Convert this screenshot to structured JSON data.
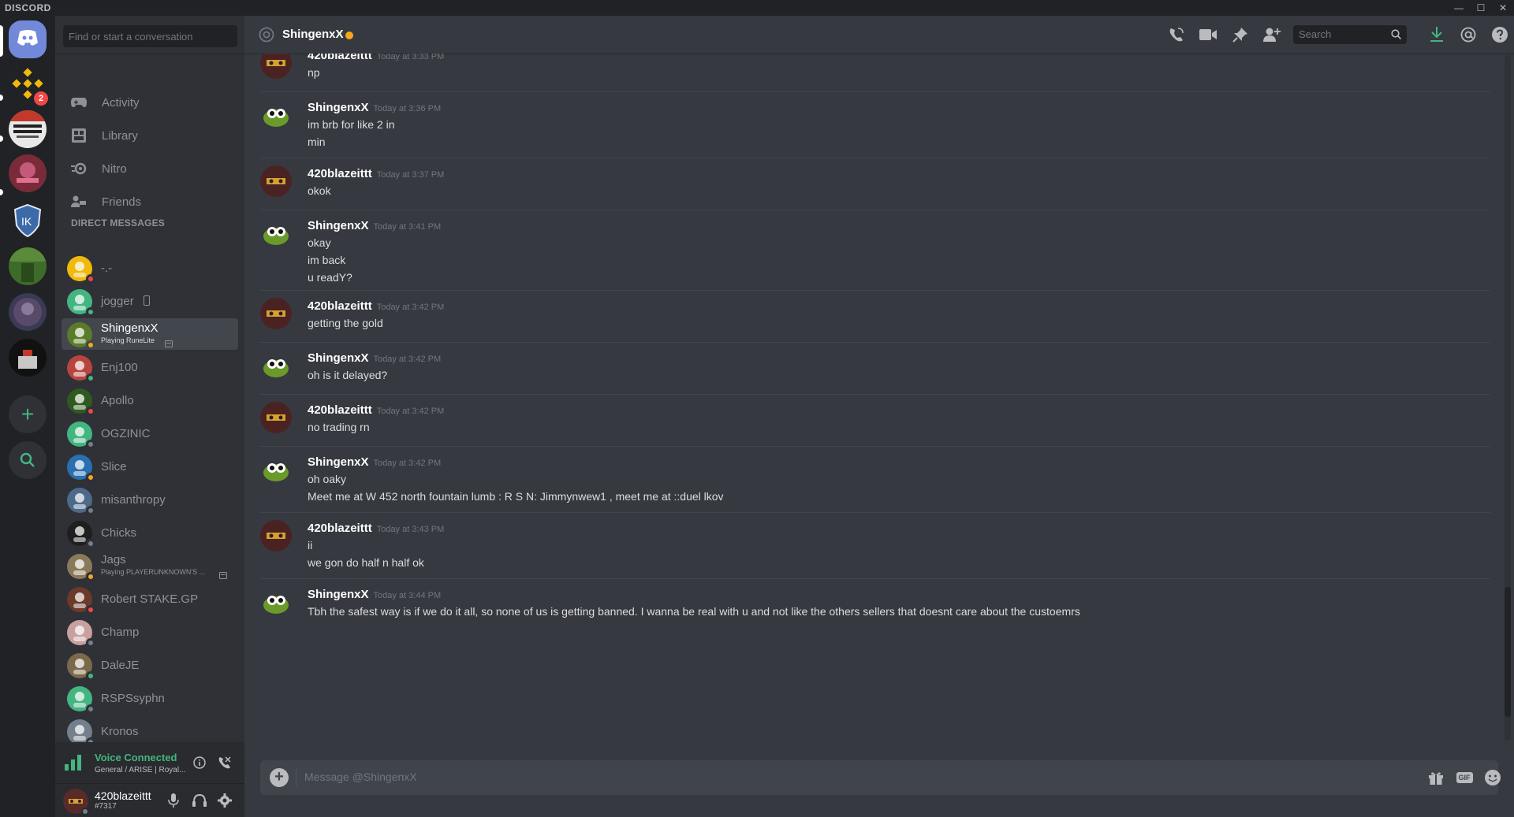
{
  "titlebar": {
    "brand": "DISCORD",
    "minimize": "—",
    "maximize": "☐",
    "close": "✕"
  },
  "guilds": {
    "badge_count": "2",
    "add": "+",
    "explore": "🔍"
  },
  "sidebar": {
    "search_placeholder": "Find or start a conversation",
    "nav": [
      {
        "label": "Activity",
        "icon": "gamepad-icon"
      },
      {
        "label": "Library",
        "icon": "library-icon"
      },
      {
        "label": "Nitro",
        "icon": "nitro-icon"
      },
      {
        "label": "Friends",
        "icon": "friends-icon"
      }
    ],
    "dm_header": "DIRECT MESSAGES",
    "dms": [
      {
        "name": "-.-",
        "sub": "",
        "status_color": "#f04747",
        "avatar_color": "#f0b90b"
      },
      {
        "name": "jogger",
        "sub": "",
        "status_color": "#43b581",
        "avatar_color": "#43b581",
        "mobile": true
      },
      {
        "name": "ShingenxX",
        "sub": "Playing RuneLite",
        "status_color": "#faa61a",
        "avatar_color": "#5a7b2a",
        "active": true
      },
      {
        "name": "Enj100",
        "sub": "",
        "status_color": "#43b581",
        "avatar_color": "#b8453d"
      },
      {
        "name": "Apollo",
        "sub": "",
        "status_color": "#f04747",
        "avatar_color": "#2e5a1f"
      },
      {
        "name": "OGZINIC",
        "sub": "",
        "status_color": "#747f8d",
        "avatar_color": "#43b581"
      },
      {
        "name": "Slice",
        "sub": "",
        "status_color": "#faa61a",
        "avatar_color": "#2a6fb0"
      },
      {
        "name": "misanthropy",
        "sub": "",
        "status_color": "#747f8d",
        "avatar_color": "#4d6a8a"
      },
      {
        "name": "Chicks",
        "sub": "",
        "status_color": "#747f8d",
        "avatar_color": "#1f1f1f"
      },
      {
        "name": "Jags",
        "sub": "Playing PLAYERUNKNOWN'S ...",
        "status_color": "#faa61a",
        "avatar_color": "#8a7a5a"
      },
      {
        "name": "Robert STAKE.GP",
        "sub": "",
        "status_color": "#f04747",
        "avatar_color": "#6a3a2a"
      },
      {
        "name": "Champ",
        "sub": "",
        "status_color": "#747f8d",
        "avatar_color": "#c8a0a0"
      },
      {
        "name": "DaleJE",
        "sub": "",
        "status_color": "#43b581",
        "avatar_color": "#7a6a4a"
      },
      {
        "name": "RSPSsyphn",
        "sub": "",
        "status_color": "#747f8d",
        "avatar_color": "#43b581"
      },
      {
        "name": "Kronos",
        "sub": "",
        "status_color": "#747f8d",
        "avatar_color": "#747f8d"
      }
    ],
    "voice": {
      "title": "Voice Connected",
      "sub": "General / ARISE | Royal..."
    },
    "user": {
      "name": "420blazeittt",
      "tag": "#7317"
    }
  },
  "chat": {
    "title": "ShingenxX",
    "search_placeholder": "Search",
    "composer_placeholder": "Message @ShingenxX",
    "gif_label": "GIF",
    "messages": [
      {
        "author": "420blazeittt",
        "time": "Today at 3:33 PM",
        "lines": [
          "np"
        ]
      },
      {
        "author": "ShingenxX",
        "time": "Today at 3:36 PM",
        "lines": [
          "im brb for like 2 in",
          "min"
        ]
      },
      {
        "author": "420blazeittt",
        "time": "Today at 3:37 PM",
        "lines": [
          "okok"
        ]
      },
      {
        "author": "ShingenxX",
        "time": "Today at 3:41 PM",
        "lines": [
          "okay",
          "im back",
          "u readY?"
        ]
      },
      {
        "author": "420blazeittt",
        "time": "Today at 3:42 PM",
        "lines": [
          "getting the gold"
        ]
      },
      {
        "author": "ShingenxX",
        "time": "Today at 3:42 PM",
        "lines": [
          "oh is it delayed?"
        ]
      },
      {
        "author": "420blazeittt",
        "time": "Today at 3:42 PM",
        "lines": [
          "no trading rn"
        ]
      },
      {
        "author": "ShingenxX",
        "time": "Today at 3:42 PM",
        "lines": [
          "oh oaky",
          "Meet me at W 452 north fountain lumb : R S N: Jimmynwew1 , meet me at ::duel lkov"
        ]
      },
      {
        "author": "420blazeittt",
        "time": "Today at 3:43 PM",
        "lines": [
          "ii",
          "we gon do half n half ok"
        ]
      },
      {
        "author": "ShingenxX",
        "time": "Today at 3:44 PM",
        "lines": [
          "Tbh the safest way is if we do it all, so none of us is getting banned. I wanna be real with u and not like the others sellers that doesnt care about the custoemrs"
        ]
      }
    ]
  }
}
